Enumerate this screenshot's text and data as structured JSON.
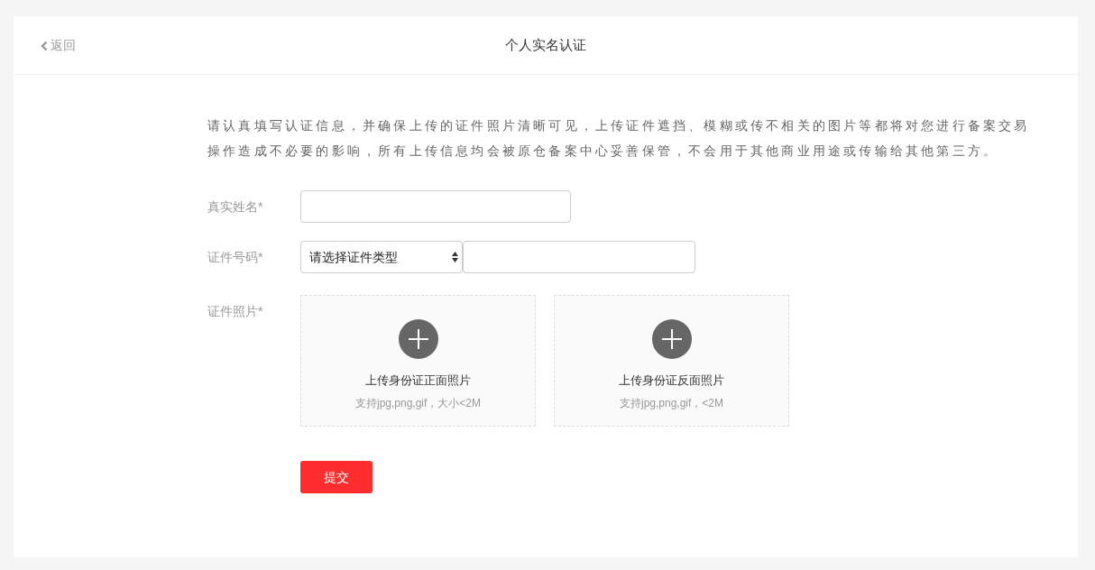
{
  "header": {
    "back": "返回",
    "title": "个人实名认证"
  },
  "intro_lines": [
    "请认真填写认证信息，并确保上传的证件照片清晰可见，上传证件遮挡、模糊或传不相关的图片等都将对您进行备案交易",
    "操作造成不必要的影响，所有上传信息均会被原仓备案中心妥善保管，不会用于其他商业用途或传输给其他第三方。"
  ],
  "name_field": {
    "label": "真实姓名*"
  },
  "id_field": {
    "label": "证件号码*",
    "select": "请选择证件类型"
  },
  "photo_field": {
    "label": "证件照片*",
    "uploads": [
      {
        "title": "上传身份证正面照片",
        "hint": "支持jpg,png,gif，大小<2M"
      },
      {
        "title": "上传身份证反面照片",
        "hint": "支持jpg,png,gif，<2M"
      }
    ]
  },
  "submit": "提交"
}
